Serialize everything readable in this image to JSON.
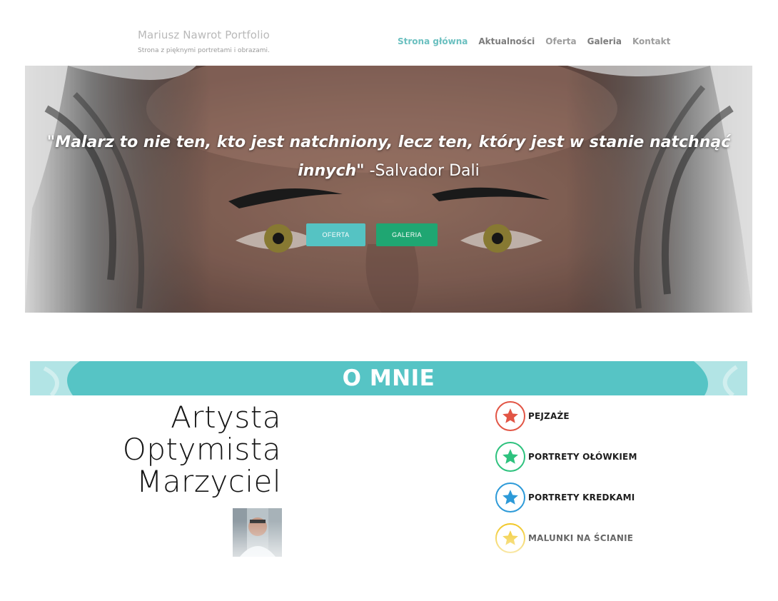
{
  "header": {
    "title": "Mariusz Nawrot Portfolio",
    "tagline": "Strona z pięknymi portretami i obrazami."
  },
  "nav": {
    "items": [
      {
        "label": "Strona główna",
        "active": true
      },
      {
        "label": "Aktualności"
      },
      {
        "label": "Oferta"
      },
      {
        "label": "Galeria"
      },
      {
        "label": "Kontakt"
      }
    ]
  },
  "hero": {
    "quote_open": "\"Malarz to nie ten, kto jest natchniony, lecz ten, który jest w stanie natchnąć innych\"",
    "quote_author": " -Salvador Dali",
    "btn_oferta": "OFERTA",
    "btn_galeria": "GALERIA"
  },
  "about": {
    "title": "O MNIE",
    "words": [
      "Artysta",
      "Optymista",
      "Marzyciel"
    ]
  },
  "skills": [
    {
      "label": "PEJZAŻE",
      "icon": "star-icon",
      "color": "#e25545"
    },
    {
      "label": "PORTRETY OŁÓWKIEM",
      "icon": "star-icon",
      "color": "#2ec27e"
    },
    {
      "label": "PORTRETY KREDKAMI",
      "icon": "star-icon",
      "color": "#2d9ad8"
    },
    {
      "label": "MALUNKI NA ŚCIANIE",
      "icon": "star-icon",
      "color": "#f0c419"
    }
  ],
  "colors": {
    "accent_teal": "#55c3c3",
    "accent_green": "#1fa672"
  }
}
